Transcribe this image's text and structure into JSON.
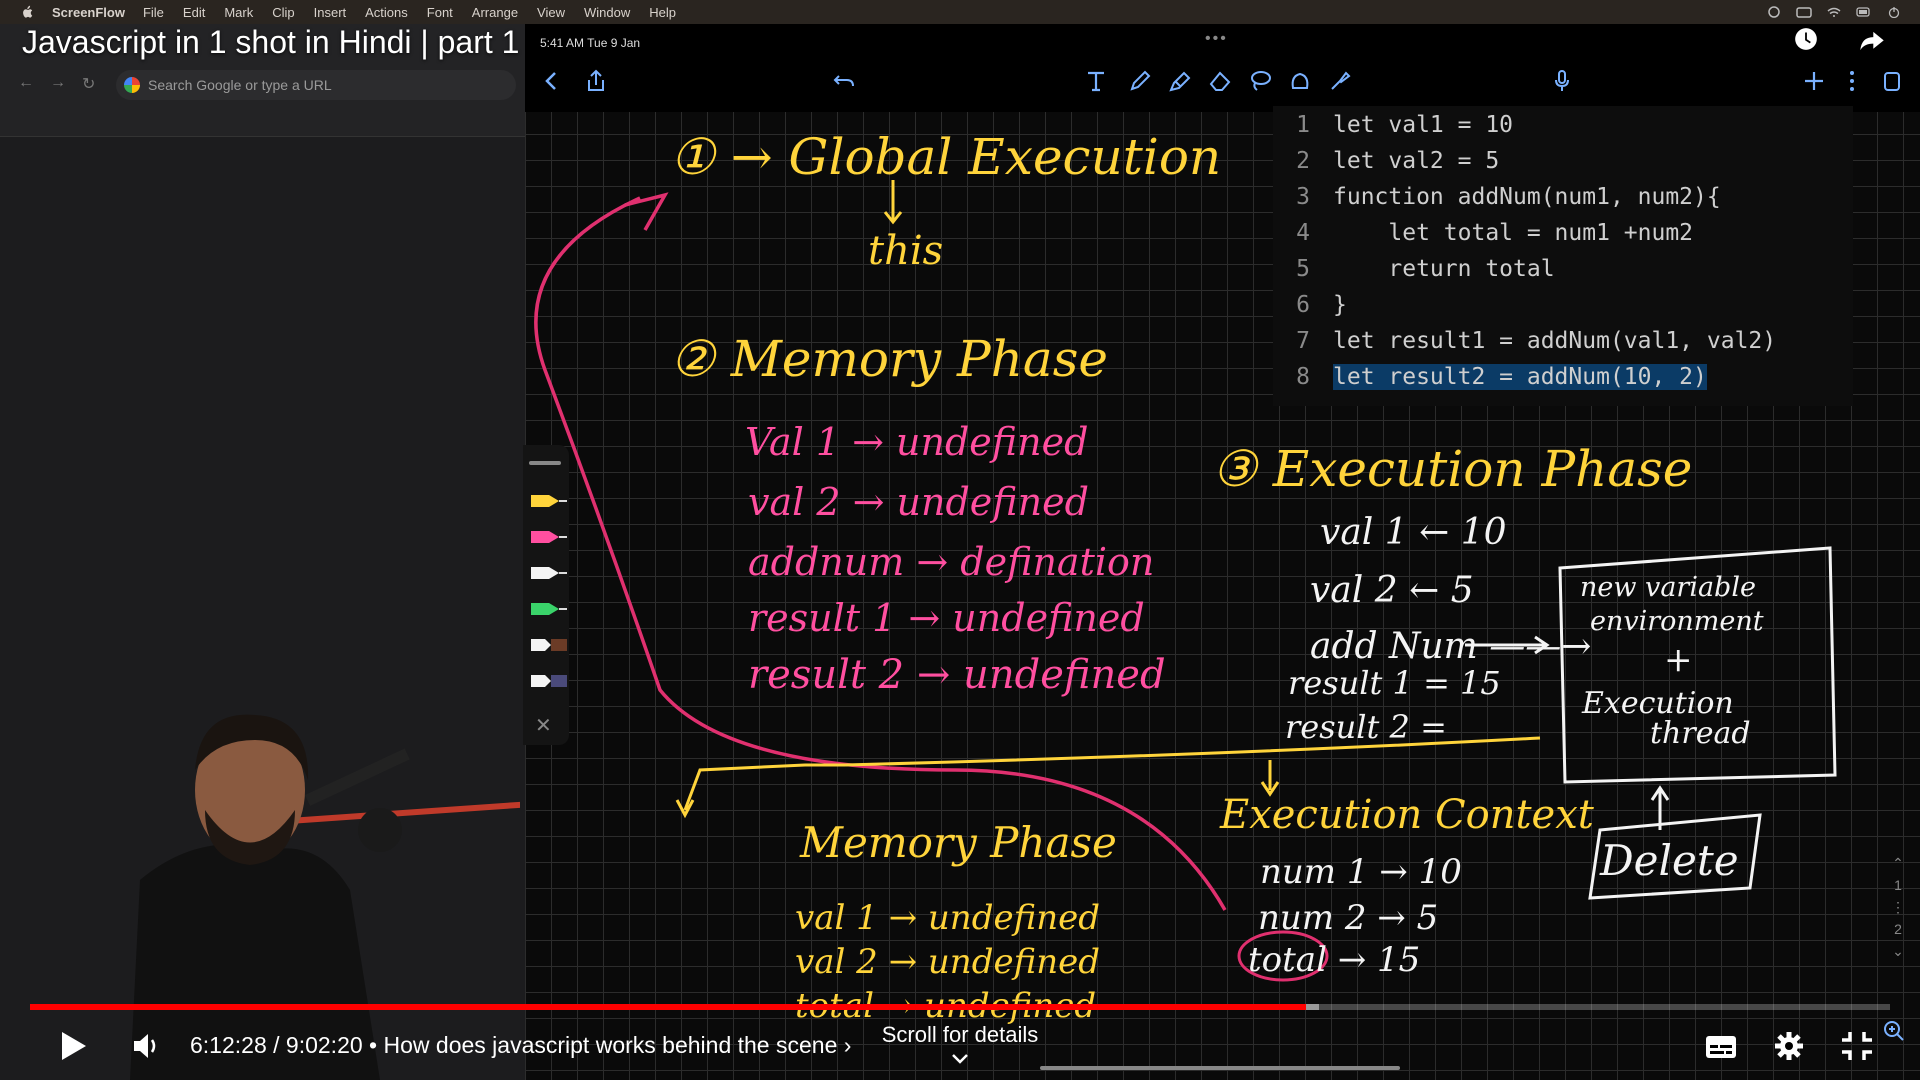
{
  "menubar": {
    "app": "ScreenFlow",
    "items": [
      "File",
      "Edit",
      "Mark",
      "Clip",
      "Insert",
      "Actions",
      "Font",
      "Arrange",
      "View",
      "Window",
      "Help"
    ]
  },
  "video": {
    "title": "Javascript in 1 shot in Hindi | part 1",
    "time_current": "6:12:28",
    "time_total": "9:02:20",
    "chapter": "How does javascript works behind the scene",
    "progress": 0.686,
    "buffered": 0.693,
    "scroll_hint": "Scroll for details"
  },
  "browser": {
    "omnibox_placeholder": "Search Google or type a URL"
  },
  "ipad": {
    "time": "5:41 AM  Tue 9 Jan",
    "dots": "•••"
  },
  "code": {
    "lines": [
      {
        "n": "1",
        "text": "let val1 = 10"
      },
      {
        "n": "2",
        "text": "let val2 = 5"
      },
      {
        "n": "3",
        "text": "function addNum(num1, num2){"
      },
      {
        "n": "4",
        "text": "    let total = num1 +num2"
      },
      {
        "n": "5",
        "text": "    return total"
      },
      {
        "n": "6",
        "text": "}"
      },
      {
        "n": "7",
        "text": "let result1 = addNum(val1, val2)"
      },
      {
        "n": "8",
        "text": "let result2 = addNum(10, 2)"
      }
    ]
  },
  "notes": {
    "n1": "① → Global Execution",
    "this": "this",
    "n2": "② Memory Phase",
    "mem": [
      "Val 1  → undefined",
      "val 2  → undefined",
      "addnum → defination",
      "result 1 → undefined",
      "result 2 → undefined"
    ],
    "n3": "③ Execution Phase",
    "exec": [
      "val 1 ← 10",
      "val 2 ← 5",
      "add Num ——→",
      "result 1 = 15",
      "result 2 ="
    ],
    "box": [
      "new variable",
      "environment",
      "+",
      "Execution",
      "thread"
    ],
    "delete": "Delete",
    "mem2_title": "Memory Phase",
    "mem2": [
      "val 1 → undefined",
      "val 2 → undefined",
      "total → undefined"
    ],
    "ctx_title": "Execution Context",
    "ctx": [
      "num 1 → 10",
      "num 2 → 5",
      "total → 15"
    ]
  },
  "colors": {
    "accent_red": "#ff0000",
    "ink_yellow": "#ffd43b",
    "ink_pink": "#ff4fa0",
    "ink_white": "#f4f4f4",
    "code_highlight": "#0b3b66"
  }
}
